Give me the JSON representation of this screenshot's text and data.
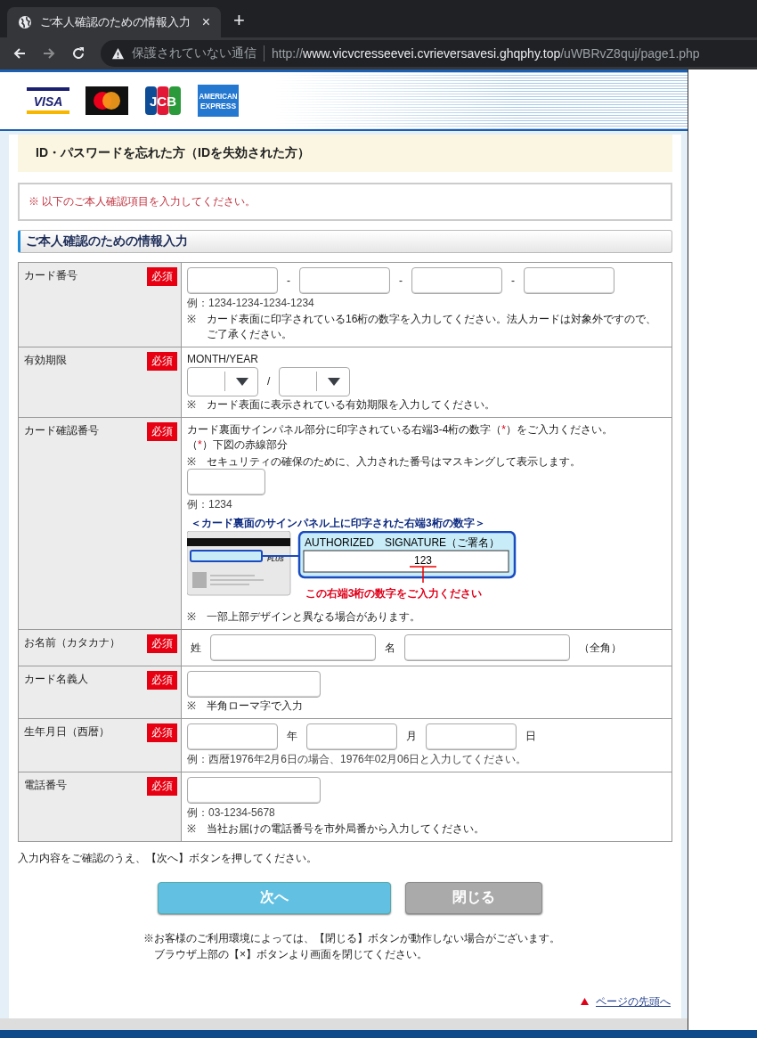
{
  "browser": {
    "tab_title": "ご本人確認のための情報入力",
    "tab_close": "×",
    "new_tab": "+",
    "security_label": "保護されていない通信",
    "url": {
      "scheme": "http://",
      "host": "www.vicvcresseevei.cvrieversavesi.ghqphy.top",
      "path": "/uWBRvZ8quj/page1.php"
    }
  },
  "header": {
    "brands": [
      {
        "kind": "visa",
        "label": "VISA"
      },
      {
        "kind": "mastercard"
      },
      {
        "kind": "jcb",
        "label": "JCB"
      },
      {
        "kind": "amex",
        "label": "AMERICAN EXPRESS"
      }
    ]
  },
  "page_title": "ID・パスワードを忘れた方（IDを失効された方）",
  "notice": "※ 以下のご本人確認項目を入力してください。",
  "section_title": "ご本人確認のための情報入力",
  "rows": [
    {
      "kind": "card_number",
      "label": "カード番号",
      "badge": "必須",
      "blocks": [
        {
          "kind": "controls",
          "parts": [
            {
              "kind": "input"
            },
            {
              "kind": "text",
              "text": "-"
            },
            {
              "kind": "input"
            },
            {
              "kind": "text",
              "text": "-"
            },
            {
              "kind": "input"
            },
            {
              "kind": "text",
              "text": "-"
            },
            {
              "kind": "input"
            }
          ]
        },
        {
          "kind": "example",
          "text": "例：1234-1234-1234-1234"
        },
        {
          "kind": "note",
          "mark": "※",
          "text": "カード表面に印字されている16桁の数字を入力してください。法人カードは対象外ですので、ご了承ください。"
        }
      ]
    },
    {
      "kind": "expiry",
      "label": "有効期限",
      "badge": "必須",
      "blocks": [
        {
          "kind": "text",
          "segments": [
            {
              "text": "MONTH/YEAR",
              "accent": false
            }
          ]
        },
        {
          "kind": "controls",
          "parts": [
            {
              "kind": "select"
            },
            {
              "kind": "text",
              "text": "/"
            },
            {
              "kind": "select"
            }
          ]
        },
        {
          "kind": "note",
          "mark": "※",
          "text": "カード表面に表示されている有効期限を入力してください。"
        }
      ]
    },
    {
      "kind": "cvv",
      "label": "カード確認番号",
      "badge": "必須",
      "blocks": [
        {
          "kind": "text",
          "segments": [
            {
              "text": "カード裏面サインパネル部分に印字されている右端3-4桁の数字（",
              "accent": false
            },
            {
              "text": "*",
              "accent": true
            },
            {
              "text": "）をご入力ください。",
              "accent": false
            }
          ]
        },
        {
          "kind": "text",
          "segments": [
            {
              "text": "（",
              "accent": false
            },
            {
              "text": "*",
              "accent": true
            },
            {
              "text": "）下図の赤線部分",
              "accent": false
            }
          ]
        },
        {
          "kind": "note",
          "mark": "※",
          "text": "セキュリティの確保のために、入力された番号はマスキングして表示します。"
        },
        {
          "kind": "controls",
          "parts": [
            {
              "kind": "input"
            }
          ]
        },
        {
          "kind": "example",
          "text": "例：1234"
        },
        {
          "kind": "diagram",
          "title": "＜カード裏面のサインパネル上に印字された右端3桁の数字＞",
          "card_logo": "PLUS",
          "panel_label": "AUTHORIZED　SIGNATURE（ご署名）",
          "digits": "123",
          "caption": "この右端3桁の数字をご入力ください"
        },
        {
          "kind": "note",
          "mark": "※",
          "text": "一部上部デザインと異なる場合があります。"
        }
      ]
    },
    {
      "kind": "name",
      "label": "お名前（カタカナ）",
      "badge": "必須",
      "blocks": [
        {
          "kind": "controls",
          "parts": [
            {
              "kind": "text",
              "text": "姓"
            },
            {
              "kind": "input"
            },
            {
              "kind": "text",
              "text": "名"
            },
            {
              "kind": "input"
            },
            {
              "kind": "text",
              "text": "（全角）"
            }
          ]
        }
      ]
    },
    {
      "kind": "holder",
      "label": "カード名義人",
      "badge": "必須",
      "blocks": [
        {
          "kind": "controls",
          "parts": [
            {
              "kind": "input"
            }
          ]
        },
        {
          "kind": "note",
          "mark": "※",
          "text": "半角ローマ字で入力"
        }
      ]
    },
    {
      "kind": "birth",
      "label": "生年月日（西暦）",
      "badge": "必須",
      "blocks": [
        {
          "kind": "controls",
          "parts": [
            {
              "kind": "input"
            },
            {
              "kind": "text",
              "text": "年"
            },
            {
              "kind": "input"
            },
            {
              "kind": "text",
              "text": "月"
            },
            {
              "kind": "input"
            },
            {
              "kind": "text",
              "text": "日"
            }
          ]
        },
        {
          "kind": "example",
          "text": "例：西暦1976年2月6日の場合、1976年02月06日と入力してください。"
        }
      ]
    },
    {
      "kind": "phone",
      "label": "電話番号",
      "badge": "必須",
      "blocks": [
        {
          "kind": "controls",
          "parts": [
            {
              "kind": "input"
            }
          ]
        },
        {
          "kind": "example",
          "text": "例：03-1234-5678"
        },
        {
          "kind": "note",
          "mark": "※",
          "text": "当社お届けの電話番号を市外局番から入力してください。"
        }
      ]
    }
  ],
  "confirm_text": "入力内容をご確認のうえ、【次へ】ボタンを押してください。",
  "buttons": [
    {
      "kind": "primary",
      "label": "次へ"
    },
    {
      "kind": "secondary",
      "label": "閉じる"
    }
  ],
  "close_notes": [
    "※お客様のご利用環境によっては、【閉じる】ボタンが動作しない場合がございます。",
    "ブラウザ上部の【×】ボタンより画面を閉じてください。"
  ],
  "page_top_link": "ページの先頭へ"
}
